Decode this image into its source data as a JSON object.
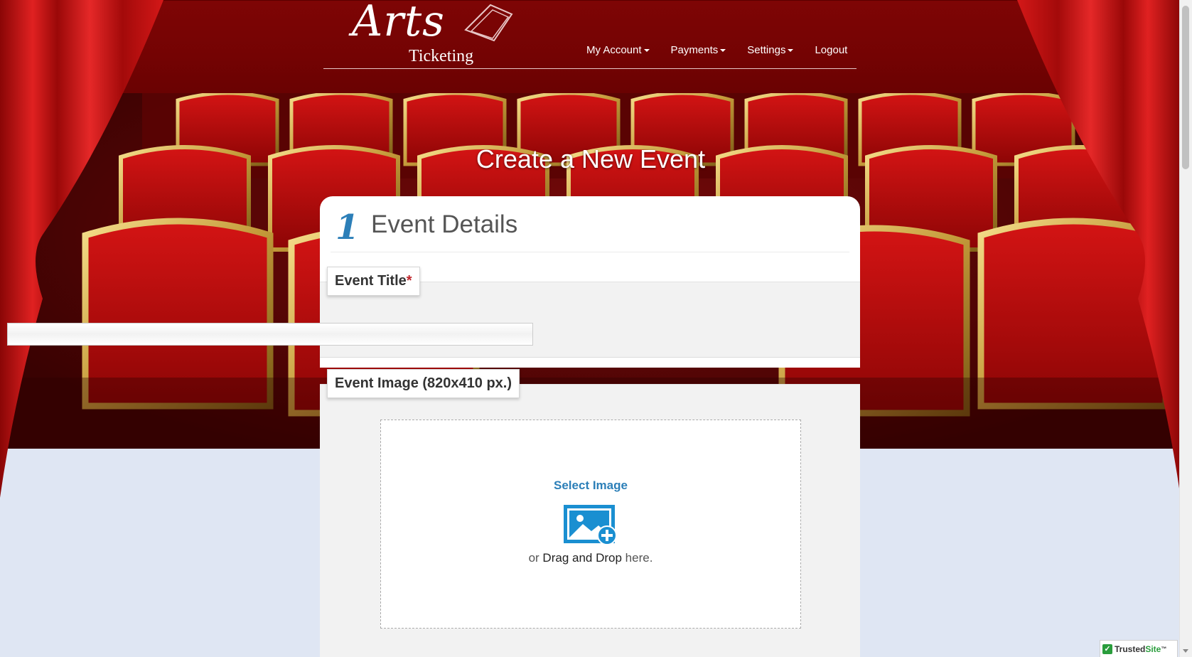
{
  "logo": {
    "script_text": "Arts",
    "sub_text": "Ticketing"
  },
  "nav": {
    "items": [
      {
        "label": "My Account",
        "dropdown": true
      },
      {
        "label": "Payments",
        "dropdown": true
      },
      {
        "label": "Settings",
        "dropdown": true
      },
      {
        "label": "Logout",
        "dropdown": false
      }
    ]
  },
  "page": {
    "title": "Create a New Event"
  },
  "card": {
    "step_number": "1",
    "title": "Event Details",
    "event_title": {
      "label": "Event Title",
      "required_mark": "*",
      "value": ""
    },
    "event_image": {
      "label": "Event Image (820x410 px.)",
      "select_label": "Select Image",
      "drag_prefix": "or",
      "drag_emphasis": "Drag and Drop",
      "drag_suffix": "here."
    }
  },
  "badge": {
    "prefix": "Trusted",
    "brand": "Site",
    "mark": "™"
  },
  "colors": {
    "header_red": "#7e0505",
    "accent_blue": "#2c7fb8",
    "required_red": "#c0272d",
    "page_background": "#dfe6f3"
  },
  "icons": {
    "image_add": "image-add-icon",
    "caret": "caret-down-icon"
  }
}
